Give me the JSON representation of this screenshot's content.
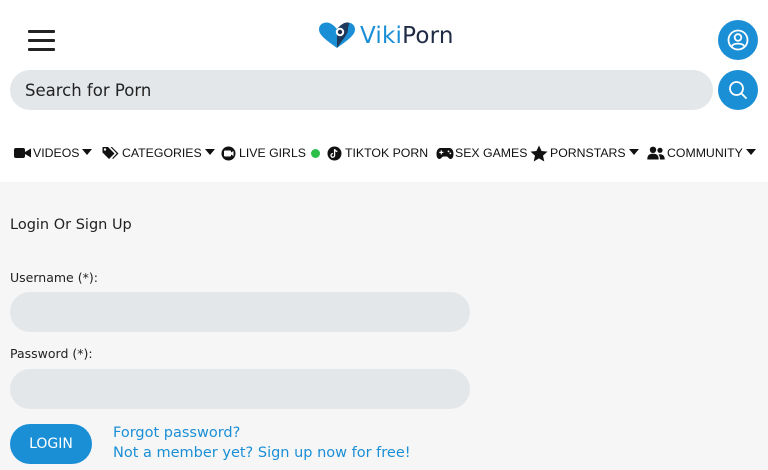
{
  "header": {
    "logo": {
      "part1": "Viki",
      "part2": "Porn"
    },
    "menu_icon": "hamburger-menu-icon",
    "user_icon": "user-account-icon"
  },
  "search": {
    "placeholder": "Search for Porn",
    "button_icon": "search-icon"
  },
  "nav": {
    "items": [
      {
        "label": "VIDEOS",
        "icon": "video-camera-icon",
        "has_dropdown": true
      },
      {
        "label": "CATEGORIES",
        "icon": "tags-icon",
        "has_dropdown": true
      },
      {
        "label": "LIVE GIRLS",
        "icon": "webcam-icon",
        "live_indicator": true
      },
      {
        "label": "TIKTOK PORN",
        "icon": "tiktok-icon"
      },
      {
        "label": "SEX GAMES",
        "icon": "gamepad-icon"
      },
      {
        "label": "PORNSTARS",
        "icon": "star-icon",
        "has_dropdown": true
      },
      {
        "label": "COMMUNITY",
        "icon": "users-icon",
        "has_dropdown": true
      }
    ]
  },
  "login": {
    "title": "Login Or Sign Up",
    "username_label": "Username (*):",
    "password_label": "Password (*):",
    "login_button": "LOGIN",
    "forgot_link": "Forgot password?",
    "signup_link": "Not a member yet? Sign up now for free!"
  },
  "colors": {
    "accent": "#1b8fd6",
    "input_bg": "#e4e7ea",
    "page_bg": "#f6f6f6",
    "live_dot": "#2bbf4a"
  }
}
